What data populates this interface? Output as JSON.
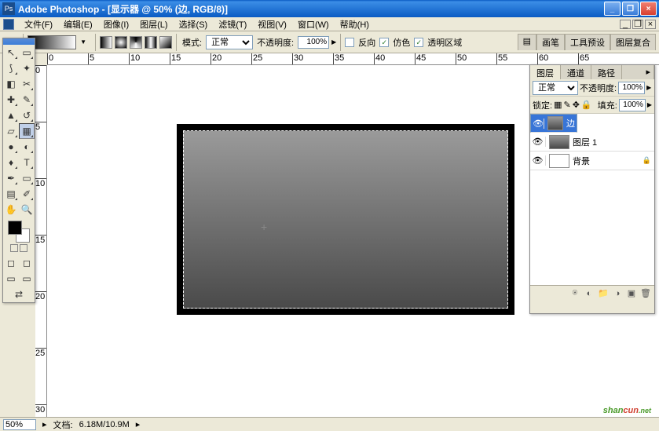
{
  "title": "Adobe Photoshop - [显示器 @ 50% (边, RGB/8)]",
  "menu": {
    "file": "文件(F)",
    "edit": "编辑(E)",
    "image": "图像(I)",
    "layer": "图层(L)",
    "select": "选择(S)",
    "filter": "滤镜(T)",
    "view": "视图(V)",
    "window": "窗口(W)",
    "help": "帮助(H)"
  },
  "options": {
    "mode_label": "模式:",
    "mode_value": "正常",
    "opacity_label": "不透明度:",
    "opacity_value": "100%",
    "reverse": "反向",
    "dither": "仿色",
    "transparency": "透明区域"
  },
  "option_tabs": {
    "brushes": "画笔",
    "tool_presets": "工具预设",
    "layer_comps": "图层复合"
  },
  "ruler_h": [
    "0",
    "5",
    "10",
    "15",
    "20",
    "25",
    "30",
    "35",
    "40",
    "45",
    "50",
    "55",
    "60",
    "65"
  ],
  "ruler_v": [
    "0",
    "5",
    "10",
    "15",
    "20",
    "25",
    "30"
  ],
  "layers_panel": {
    "tabs": {
      "layers": "图层",
      "channels": "通道",
      "paths": "路径"
    },
    "blend_label": "正常",
    "opacity_label": "不透明度:",
    "opacity_value": "100%",
    "lock_label": "锁定:",
    "fill_label": "填充:",
    "fill_value": "100%",
    "items": [
      {
        "name": "边",
        "selected": true,
        "thumb": "grad"
      },
      {
        "name": "图层 1",
        "selected": false,
        "thumb": "grad"
      },
      {
        "name": "背景",
        "selected": false,
        "thumb": "white",
        "locked": true
      }
    ]
  },
  "status": {
    "zoom": "50%",
    "doc_label": "文档:",
    "doc_size": "6.18M/10.9M"
  },
  "watermark": {
    "a": "shan",
    "b": "cun",
    "c": ".net"
  }
}
